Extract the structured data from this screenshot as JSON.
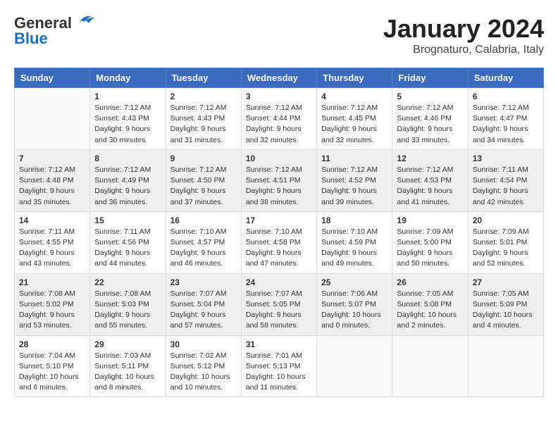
{
  "header": {
    "logo_line1": "General",
    "logo_line2": "Blue",
    "month": "January 2024",
    "location": "Brognaturo, Calabria, Italy"
  },
  "weekdays": [
    "Sunday",
    "Monday",
    "Tuesday",
    "Wednesday",
    "Thursday",
    "Friday",
    "Saturday"
  ],
  "weeks": [
    [
      {
        "day": "",
        "info": ""
      },
      {
        "day": "1",
        "info": "Sunrise: 7:12 AM\nSunset: 4:43 PM\nDaylight: 9 hours\nand 30 minutes."
      },
      {
        "day": "2",
        "info": "Sunrise: 7:12 AM\nSunset: 4:43 PM\nDaylight: 9 hours\nand 31 minutes."
      },
      {
        "day": "3",
        "info": "Sunrise: 7:12 AM\nSunset: 4:44 PM\nDaylight: 9 hours\nand 32 minutes."
      },
      {
        "day": "4",
        "info": "Sunrise: 7:12 AM\nSunset: 4:45 PM\nDaylight: 9 hours\nand 32 minutes."
      },
      {
        "day": "5",
        "info": "Sunrise: 7:12 AM\nSunset: 4:46 PM\nDaylight: 9 hours\nand 33 minutes."
      },
      {
        "day": "6",
        "info": "Sunrise: 7:12 AM\nSunset: 4:47 PM\nDaylight: 9 hours\nand 34 minutes."
      }
    ],
    [
      {
        "day": "7",
        "info": "Sunrise: 7:12 AM\nSunset: 4:48 PM\nDaylight: 9 hours\nand 35 minutes."
      },
      {
        "day": "8",
        "info": "Sunrise: 7:12 AM\nSunset: 4:49 PM\nDaylight: 9 hours\nand 36 minutes."
      },
      {
        "day": "9",
        "info": "Sunrise: 7:12 AM\nSunset: 4:50 PM\nDaylight: 9 hours\nand 37 minutes."
      },
      {
        "day": "10",
        "info": "Sunrise: 7:12 AM\nSunset: 4:51 PM\nDaylight: 9 hours\nand 38 minutes."
      },
      {
        "day": "11",
        "info": "Sunrise: 7:12 AM\nSunset: 4:52 PM\nDaylight: 9 hours\nand 39 minutes."
      },
      {
        "day": "12",
        "info": "Sunrise: 7:12 AM\nSunset: 4:53 PM\nDaylight: 9 hours\nand 41 minutes."
      },
      {
        "day": "13",
        "info": "Sunrise: 7:11 AM\nSunset: 4:54 PM\nDaylight: 9 hours\nand 42 minutes."
      }
    ],
    [
      {
        "day": "14",
        "info": "Sunrise: 7:11 AM\nSunset: 4:55 PM\nDaylight: 9 hours\nand 43 minutes."
      },
      {
        "day": "15",
        "info": "Sunrise: 7:11 AM\nSunset: 4:56 PM\nDaylight: 9 hours\nand 44 minutes."
      },
      {
        "day": "16",
        "info": "Sunrise: 7:10 AM\nSunset: 4:57 PM\nDaylight: 9 hours\nand 46 minutes."
      },
      {
        "day": "17",
        "info": "Sunrise: 7:10 AM\nSunset: 4:58 PM\nDaylight: 9 hours\nand 47 minutes."
      },
      {
        "day": "18",
        "info": "Sunrise: 7:10 AM\nSunset: 4:59 PM\nDaylight: 9 hours\nand 49 minutes."
      },
      {
        "day": "19",
        "info": "Sunrise: 7:09 AM\nSunset: 5:00 PM\nDaylight: 9 hours\nand 50 minutes."
      },
      {
        "day": "20",
        "info": "Sunrise: 7:09 AM\nSunset: 5:01 PM\nDaylight: 9 hours\nand 52 minutes."
      }
    ],
    [
      {
        "day": "21",
        "info": "Sunrise: 7:08 AM\nSunset: 5:02 PM\nDaylight: 9 hours\nand 53 minutes."
      },
      {
        "day": "22",
        "info": "Sunrise: 7:08 AM\nSunset: 5:03 PM\nDaylight: 9 hours\nand 55 minutes."
      },
      {
        "day": "23",
        "info": "Sunrise: 7:07 AM\nSunset: 5:04 PM\nDaylight: 9 hours\nand 57 minutes."
      },
      {
        "day": "24",
        "info": "Sunrise: 7:07 AM\nSunset: 5:05 PM\nDaylight: 9 hours\nand 58 minutes."
      },
      {
        "day": "25",
        "info": "Sunrise: 7:06 AM\nSunset: 5:07 PM\nDaylight: 10 hours\nand 0 minutes."
      },
      {
        "day": "26",
        "info": "Sunrise: 7:05 AM\nSunset: 5:08 PM\nDaylight: 10 hours\nand 2 minutes."
      },
      {
        "day": "27",
        "info": "Sunrise: 7:05 AM\nSunset: 5:09 PM\nDaylight: 10 hours\nand 4 minutes."
      }
    ],
    [
      {
        "day": "28",
        "info": "Sunrise: 7:04 AM\nSunset: 5:10 PM\nDaylight: 10 hours\nand 6 minutes."
      },
      {
        "day": "29",
        "info": "Sunrise: 7:03 AM\nSunset: 5:11 PM\nDaylight: 10 hours\nand 8 minutes."
      },
      {
        "day": "30",
        "info": "Sunrise: 7:02 AM\nSunset: 5:12 PM\nDaylight: 10 hours\nand 10 minutes."
      },
      {
        "day": "31",
        "info": "Sunrise: 7:01 AM\nSunset: 5:13 PM\nDaylight: 10 hours\nand 11 minutes."
      },
      {
        "day": "",
        "info": ""
      },
      {
        "day": "",
        "info": ""
      },
      {
        "day": "",
        "info": ""
      }
    ]
  ]
}
